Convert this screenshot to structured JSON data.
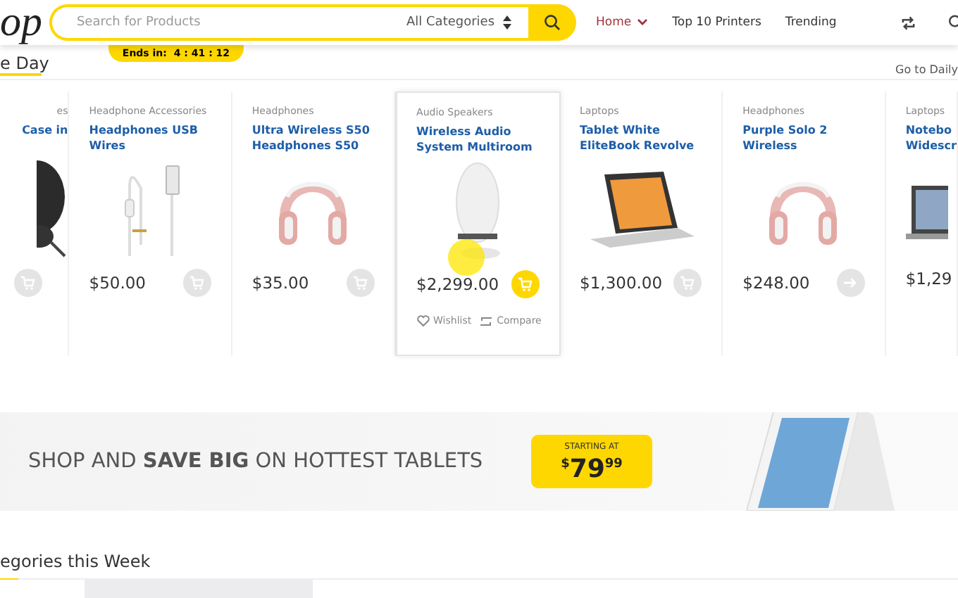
{
  "header": {
    "logo": "op",
    "search": {
      "placeholder": "Search for Products",
      "category": "All Categories"
    },
    "nav": [
      {
        "label": "Home",
        "selected": true,
        "dropdown": true
      },
      {
        "label": "Top 10 Printers",
        "selected": false,
        "dropdown": false
      },
      {
        "label": "Trending",
        "selected": false,
        "dropdown": false
      }
    ]
  },
  "deals": {
    "title": "e Day",
    "timer": "Ends in:  4 : 41 : 12",
    "link": "Go to Daily"
  },
  "products": [
    {
      "kind": "case",
      "category": "es",
      "name": "Case in",
      "button": {
        "kind": "cart"
      },
      "highlighted": false
    },
    {
      "kind": "cable",
      "category": "Headphone Accessories",
      "name": "Headphones USB Wires",
      "price": "$50.00",
      "button": {
        "kind": "cart"
      },
      "highlighted": false
    },
    {
      "kind": "headphones",
      "category": "Headphones",
      "name": "Ultra Wireless S50 Headphones S50",
      "price": "$35.00",
      "button": {
        "kind": "cart"
      },
      "highlighted": false
    },
    {
      "kind": "speaker",
      "category": "Audio Speakers",
      "name": "Wireless Audio System Multiroom",
      "price": "$2,299.00",
      "button": {
        "kind": "cart"
      },
      "highlighted": true,
      "wishlist": "Wishlist",
      "compare": "Compare"
    },
    {
      "kind": "laptop",
      "category": "Laptops",
      "name": "Tablet White EliteBook Revolve",
      "price": "$1,300.00",
      "button": {
        "kind": "cart"
      },
      "highlighted": false
    },
    {
      "kind": "headphones",
      "category": "Headphones",
      "name": "Purple Solo 2 Wireless",
      "price": "$248.00",
      "button": {
        "kind": "arrow"
      },
      "highlighted": false
    },
    {
      "kind": "notebook",
      "category": "Laptops",
      "name": "Notebo Widescr",
      "price": "$1,29",
      "highlighted": false
    }
  ],
  "banner": {
    "text": "SHOP AND **SAVE BIG** ON HOTTEST TABLETS",
    "starting": "STARTING AT",
    "currency": "$",
    "amount": "79",
    "cents": "99"
  },
  "section": {
    "title": "egories this Week"
  }
}
